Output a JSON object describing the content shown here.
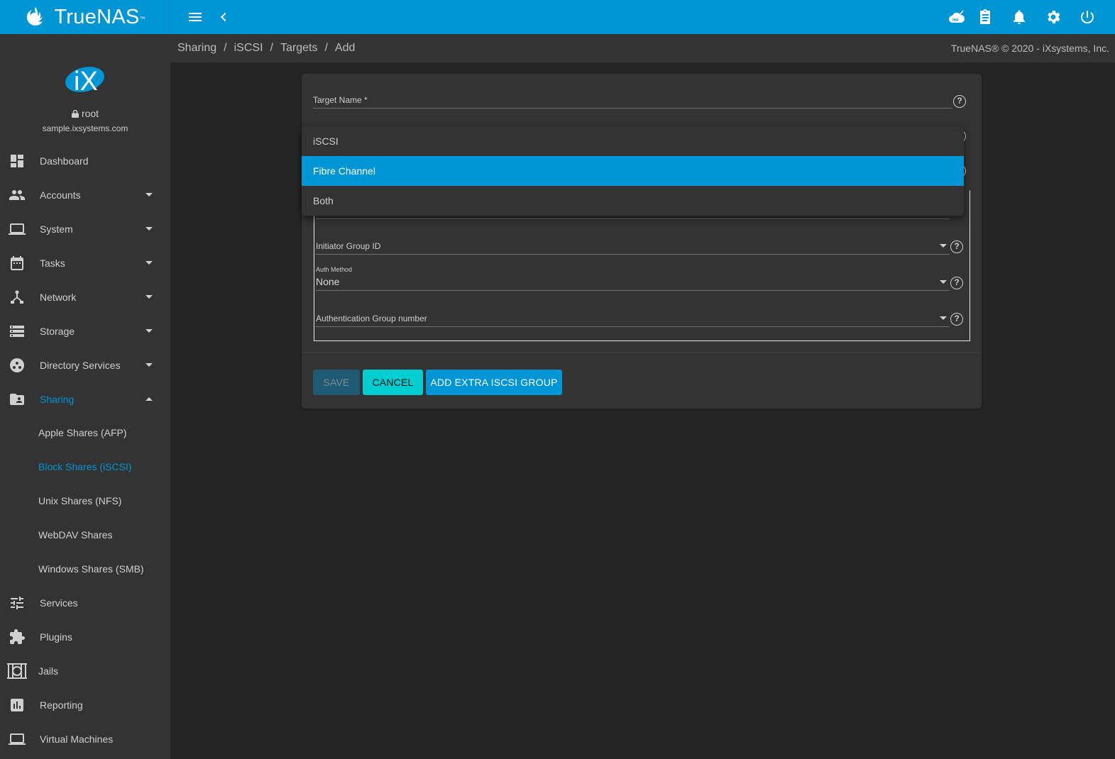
{
  "topbar": {
    "brand": "TrueNAS",
    "brand_mark": "™",
    "icons": [
      "menu-icon",
      "chevron-left-icon",
      "ha-status-icon",
      "task-manager-icon",
      "notifications-icon",
      "settings-icon",
      "power-icon"
    ]
  },
  "profile": {
    "logo": "iX",
    "user": "root",
    "host": "sample.ixsystems.com"
  },
  "sidebar": {
    "items": [
      {
        "label": "Dashboard",
        "icon": "dashboard-icon",
        "expandable": false
      },
      {
        "label": "Accounts",
        "icon": "people-icon",
        "expandable": true
      },
      {
        "label": "System",
        "icon": "laptop-icon",
        "expandable": true
      },
      {
        "label": "Tasks",
        "icon": "calendar-icon",
        "expandable": true
      },
      {
        "label": "Network",
        "icon": "network-icon",
        "expandable": true
      },
      {
        "label": "Storage",
        "icon": "storage-icon",
        "expandable": true
      },
      {
        "label": "Directory Services",
        "icon": "directory-services-icon",
        "expandable": true
      },
      {
        "label": "Sharing",
        "icon": "shared-folder-icon",
        "expandable": true,
        "expanded": true,
        "active": true
      },
      {
        "label": "Services",
        "icon": "tune-icon",
        "expandable": false
      },
      {
        "label": "Plugins",
        "icon": "puzzle-icon",
        "expandable": false
      },
      {
        "label": "Jails",
        "icon": "jail-icon",
        "expandable": false
      },
      {
        "label": "Reporting",
        "icon": "chart-icon",
        "expandable": false
      },
      {
        "label": "Virtual Machines",
        "icon": "laptop-icon",
        "expandable": false
      }
    ],
    "sharing_sub": [
      {
        "label": "Apple Shares (AFP)"
      },
      {
        "label": "Block Shares (iSCSI)",
        "active": true
      },
      {
        "label": "Unix Shares (NFS)"
      },
      {
        "label": "WebDAV Shares"
      },
      {
        "label": "Windows Shares (SMB)"
      }
    ]
  },
  "breadcrumb": [
    "Sharing",
    "iSCSI",
    "Targets",
    "Add"
  ],
  "breadcrumb_sep": "/",
  "copyright": "TrueNAS® © 2020 - iXsystems, Inc.",
  "form": {
    "target_name_label": "Target Name *",
    "target_name_value": "",
    "initiator_group_label": "Initiator Group ID",
    "auth_method_label": "Auth Method",
    "auth_method_value": "None",
    "auth_group_label": "Authentication Group number",
    "help_glyph": "?"
  },
  "dropdown": {
    "options": [
      "iSCSI",
      "Fibre Channel",
      "Both"
    ],
    "selected": "Fibre Channel"
  },
  "buttons": {
    "save": "SAVE",
    "cancel": "CANCEL",
    "add_group": "ADD EXTRA ISCSI GROUP"
  },
  "colors": {
    "accent": "#0095d5",
    "cancel": "#00ced1",
    "save_disabled": "#1f5a74",
    "sidebar_bg": "#333333",
    "content_bg": "#252525"
  }
}
